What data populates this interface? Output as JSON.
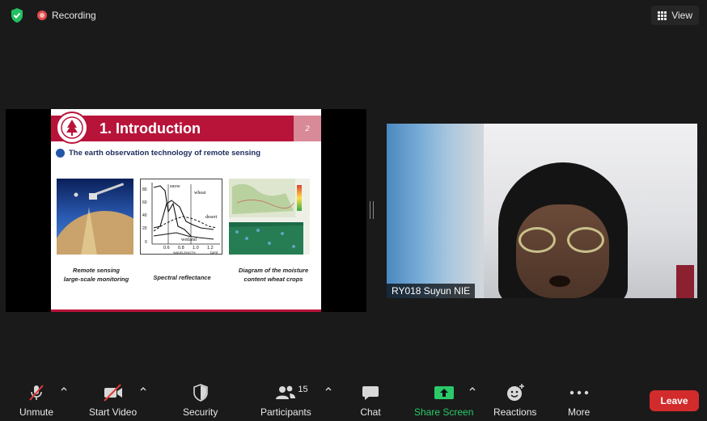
{
  "top": {
    "recording_label": "Recording",
    "view_label": "View"
  },
  "slide": {
    "title": "1. Introduction",
    "page_number": "2",
    "subtitle": "The earth observation technology of remote sensing",
    "captions": [
      {
        "line1": "Remote sensing",
        "line2": "large-scale monitoring"
      },
      {
        "line1": "Spectral reflectance",
        "line2": ""
      },
      {
        "line1": "Diagram of the  moisture",
        "line2": "content  wheat crops"
      }
    ],
    "chart_labels": {
      "snow": "snow",
      "wheat": "wheat",
      "desert": "desert",
      "wetland": "wetland",
      "x_label": "WAVELENGTH",
      "x_unit": "(μm)",
      "y_label": "REFLECTANCE",
      "y_ticks": [
        "80",
        "60",
        "40",
        "20",
        "0"
      ],
      "x_ticks": [
        "0.6",
        "0.8",
        "1.0",
        "1.2"
      ]
    }
  },
  "participant": {
    "name": "RY018 Suyun NIE"
  },
  "toolbar": {
    "unmute": "Unmute",
    "start_video": "Start Video",
    "security": "Security",
    "participants": "Participants",
    "participants_count": "15",
    "chat": "Chat",
    "share_screen": "Share Screen",
    "reactions": "Reactions",
    "more": "More",
    "leave": "Leave"
  },
  "colors": {
    "accent_green": "#2ac96a",
    "leave_red": "#d22b2b",
    "slide_red": "#b8143a"
  }
}
